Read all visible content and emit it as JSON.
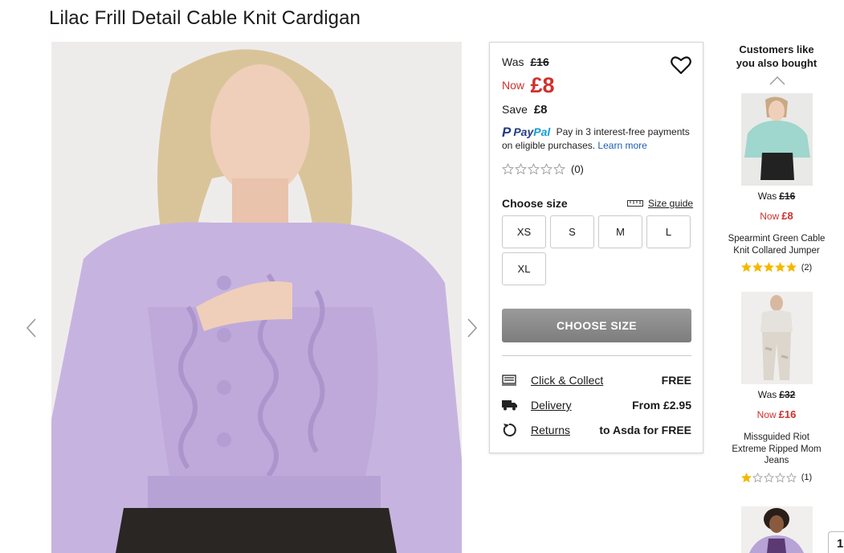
{
  "product": {
    "title": "Lilac Frill Detail Cable Knit Cardigan"
  },
  "price": {
    "was_label": "Was",
    "was_value": "£16",
    "now_label": "Now",
    "now_value": "£8",
    "save_label": "Save",
    "save_value": "£8"
  },
  "paypal": {
    "logo_p": "P",
    "logo_pay": "Pay",
    "logo_pal": "Pal",
    "message": "Pay in 3 interest-free payments on eligible purchases.",
    "learn_more": "Learn more"
  },
  "rating": {
    "stars": 0,
    "count": "(0)"
  },
  "sizes": {
    "label": "Choose size",
    "guide": "Size guide",
    "options": [
      "XS",
      "S",
      "M",
      "L",
      "XL"
    ]
  },
  "cta": {
    "label": "CHOOSE SIZE"
  },
  "services": [
    {
      "label": "Click & Collect",
      "value": "FREE",
      "icon": "store-icon"
    },
    {
      "label": "Delivery",
      "value": "From £2.95",
      "icon": "truck-icon"
    },
    {
      "label": "Returns",
      "value": "to Asda for FREE",
      "icon": "return-icon"
    }
  ],
  "recommendations": {
    "title_line1": "Customers like",
    "title_line2": "you also bought",
    "items": [
      {
        "was_label": "Was",
        "was": "£16",
        "now_label": "Now",
        "now": "£8",
        "name": "Spearmint Green Cable Knit Collared Jumper",
        "stars": 5,
        "count": "(2)"
      },
      {
        "was_label": "Was",
        "was": "£32",
        "now_label": "Now",
        "now": "£16",
        "name": "Missguided Riot Extreme Ripped Mom Jeans",
        "stars": 1,
        "count": "(1)"
      }
    ]
  },
  "page_indicator": "1",
  "colors": {
    "sale_red": "#d0312d",
    "star_gold": "#f5b800",
    "paypal_navy": "#253b80",
    "paypal_blue": "#179bd7"
  }
}
